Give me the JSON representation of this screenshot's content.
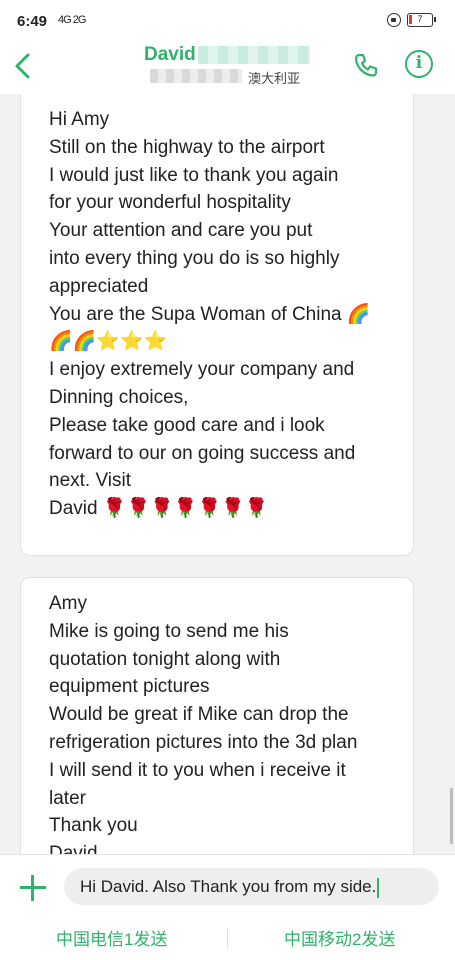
{
  "status_bar": {
    "time": "6:49",
    "signal": "4G 2G",
    "battery": "7"
  },
  "header": {
    "contact_name": "David",
    "location": "澳大利亚"
  },
  "messages": [
    {
      "lines": [
        "Hi Amy",
        "Still on the highway to the airport",
        "I would just like to thank you again",
        "for your wonderful hospitality",
        "Your attention and care you put",
        "into every thing you do is so highly",
        "appreciated",
        "You are the Supa Woman of China 🌈",
        "🌈🌈⭐⭐⭐",
        "I enjoy extremely your company and",
        "Dinning choices,",
        "Please take good care and i look",
        "forward to our on going success and",
        "next. Visit",
        "David 🌹🌹🌹🌹🌹🌹🌹"
      ]
    },
    {
      "lines": [
        "Amy",
        "Mike is going to send me his",
        "quotation tonight along with",
        "equipment pictures",
        "Would be great if Mike can drop the",
        "refrigeration pictures into the 3d plan",
        "I will send it to you when i receive it",
        "later",
        "Thank you",
        "David"
      ]
    }
  ],
  "composer": {
    "input_value": "Hi David. Also Thank you from my side.",
    "send_sim1": "中国电信1发送",
    "send_sim2": "中国移动2发送"
  },
  "colors": {
    "accent": "#2db36a",
    "background": "#f2f2f2",
    "bubble": "#ffffff"
  },
  "icons": [
    "back-arrow-icon",
    "phone-icon",
    "info-icon",
    "add-icon",
    "lock-icon",
    "battery-icon"
  ]
}
